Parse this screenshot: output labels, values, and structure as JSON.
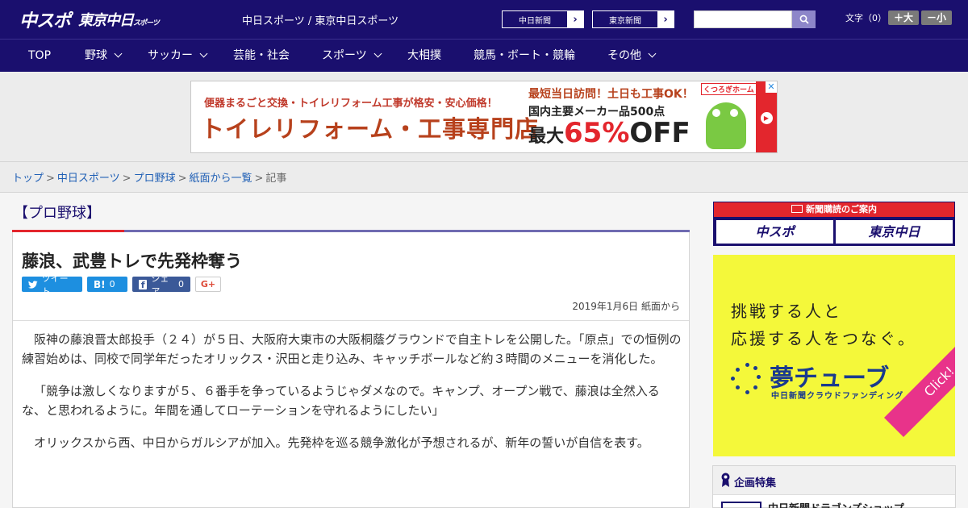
{
  "header": {
    "logo_main": "中スポ",
    "logo_tokyo": "東京中日",
    "logo_tokyo_small": "スポーツ",
    "site_name": "中日スポーツ / 東京中日スポーツ",
    "paper_links": [
      {
        "label": "中日新聞"
      },
      {
        "label": "東京新聞"
      }
    ],
    "font_size_label": "文字（0）",
    "font_plus": "＋大",
    "font_minus": "－小"
  },
  "nav": {
    "items": [
      {
        "label": "TOP",
        "has_menu": false
      },
      {
        "label": "野球",
        "has_menu": true
      },
      {
        "label": "サッカー",
        "has_menu": true
      },
      {
        "label": "芸能・社会",
        "has_menu": false
      },
      {
        "label": "スポーツ",
        "has_menu": true
      },
      {
        "label": "大相撲",
        "has_menu": false
      },
      {
        "label": "競馬・ボート・競輪",
        "has_menu": false
      },
      {
        "label": "その他",
        "has_menu": true
      }
    ]
  },
  "ad": {
    "sub": "便器まるごと交換・トイレリフォーム工事が格安・安心価格！",
    "main": "トイレリフォーム・工事専門店",
    "right_line1": "最短当日訪問！土日も工事OK！",
    "right_line2": "国内主要メーカー品500点",
    "right_line3_prefix": "最大",
    "right_line3_pct": "65%",
    "right_line3_suffix": "OFF",
    "brand": "くつろぎホーム"
  },
  "breadcrumb": {
    "items": [
      "トップ",
      "中日スポーツ",
      "プロ野球",
      "紙面から一覧"
    ],
    "current": "記事"
  },
  "article": {
    "category": "【プロ野球】",
    "title": "藤浪、武豊トレで先発枠奪う",
    "share": {
      "tweet": "ツイート",
      "hatena": "B!",
      "hatena_count": "0",
      "facebook": "シェア",
      "facebook_count": "0",
      "gplus": "G+"
    },
    "date": "2019年1月6日 紙面から",
    "paragraphs": [
      "阪神の藤浪晋太郎投手（２４）が５日、大阪府大東市の大阪桐蔭グラウンドで自主トレを公開した。「原点」での恒例の練習始めは、同校で同学年だったオリックス・沢田と走り込み、キャッチボールなど約３時間のメニューを消化した。",
      "「競争は激しくなりますが５、６番手を争っているようじゃダメなので。キャンプ、オープン戦で、藤浪は全然入るな、と思われるように。年間を通してローテーションを守れるようにしたい」",
      "オリックスから西、中日からガルシアが加入。先発枠を巡る競争激化が予想されるが、新年の誓いが自信を表す。"
    ]
  },
  "sidebar": {
    "subscribe_head": "新聞購読のご案内",
    "subscribe_btn1": "中スポ",
    "subscribe_btn2": "東京中日",
    "ad_line1": "挑戦する人と",
    "ad_line2": "応援する人をつなぐ。",
    "ad_logo": "夢チューブ",
    "ad_logo_sub": "中日新聞クラウドファンディング",
    "ad_click": "Click!",
    "feature_head": "企画特集",
    "feature_item": "中日新聞ドラゴンズショップ"
  },
  "colors": {
    "brand_navy": "#1a0f6e",
    "accent_red": "#e3262d",
    "link_blue": "#1f5fb5"
  }
}
